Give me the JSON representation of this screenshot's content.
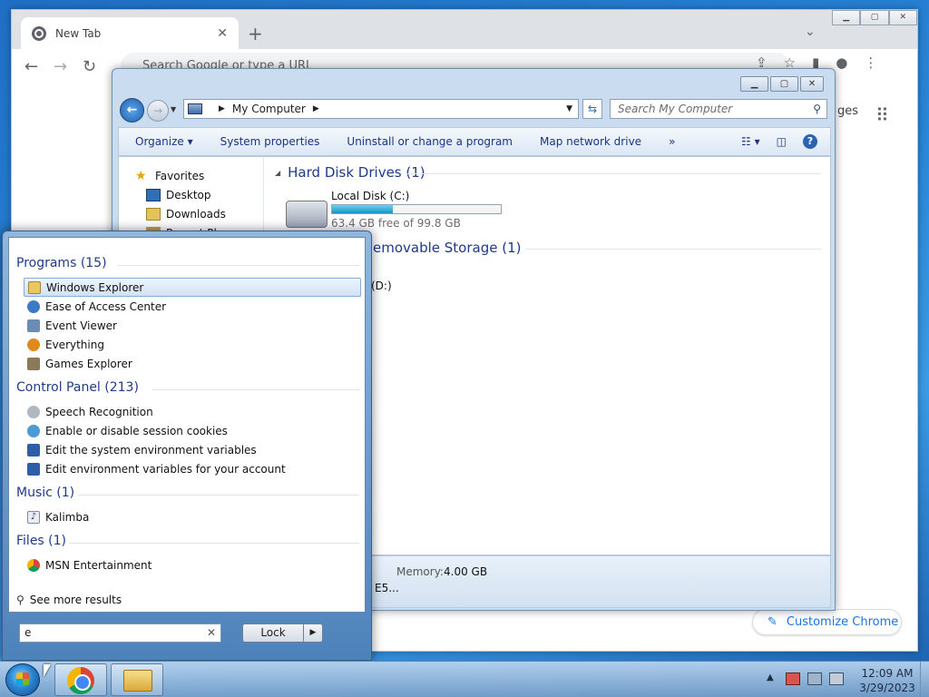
{
  "chrome": {
    "tab_title": "New Tab",
    "omnibox_placeholder": "Search Google or type a URL",
    "images_partial": "ges",
    "customize_label": "Customize Chrome"
  },
  "explorer": {
    "address_location": "My Computer",
    "search_placeholder": "Search My Computer",
    "commands": [
      "Organize",
      "System properties",
      "Uninstall or change a program",
      "Map network drive",
      "»"
    ],
    "nav": [
      "Favorites",
      "Desktop",
      "Downloads",
      "Recent Places"
    ],
    "hard_disk_header": "Hard Disk Drives (1)",
    "disk_name": "Local Disk (C:)",
    "disk_free_text": "63.4 GB free of 99.8 GB",
    "disk_used_fraction": 0.36,
    "removable_header": "emovable Storage (1)",
    "removable_drive_partial": "(D:)",
    "memory_label": "Memory:",
    "memory_value": "4.00 GB",
    "cpu_partial": "E5..."
  },
  "startmenu": {
    "sections": [
      {
        "title": "Programs (15)",
        "items": [
          "Windows Explorer",
          "Ease of Access Center",
          "Event Viewer",
          "Everything",
          "Games Explorer"
        ]
      },
      {
        "title": "Control Panel (213)",
        "items": [
          "Speech Recognition",
          "Enable or disable session cookies",
          "Edit the system environment variables",
          "Edit environment variables for your account"
        ]
      },
      {
        "title": "Music (1)",
        "items": [
          "Kalimba"
        ]
      },
      {
        "title": "Files (1)",
        "items": [
          "MSN Entertainment"
        ]
      }
    ],
    "see_more": "See more results",
    "search_value": "e",
    "lock_label": "Lock"
  },
  "taskbar": {
    "time": "12:09 AM",
    "date": "3/29/2023"
  },
  "colors": {
    "selection": "#cfe2f7",
    "link_blue": "#1e3a8a",
    "disk_fill": "#1b8fc6"
  }
}
